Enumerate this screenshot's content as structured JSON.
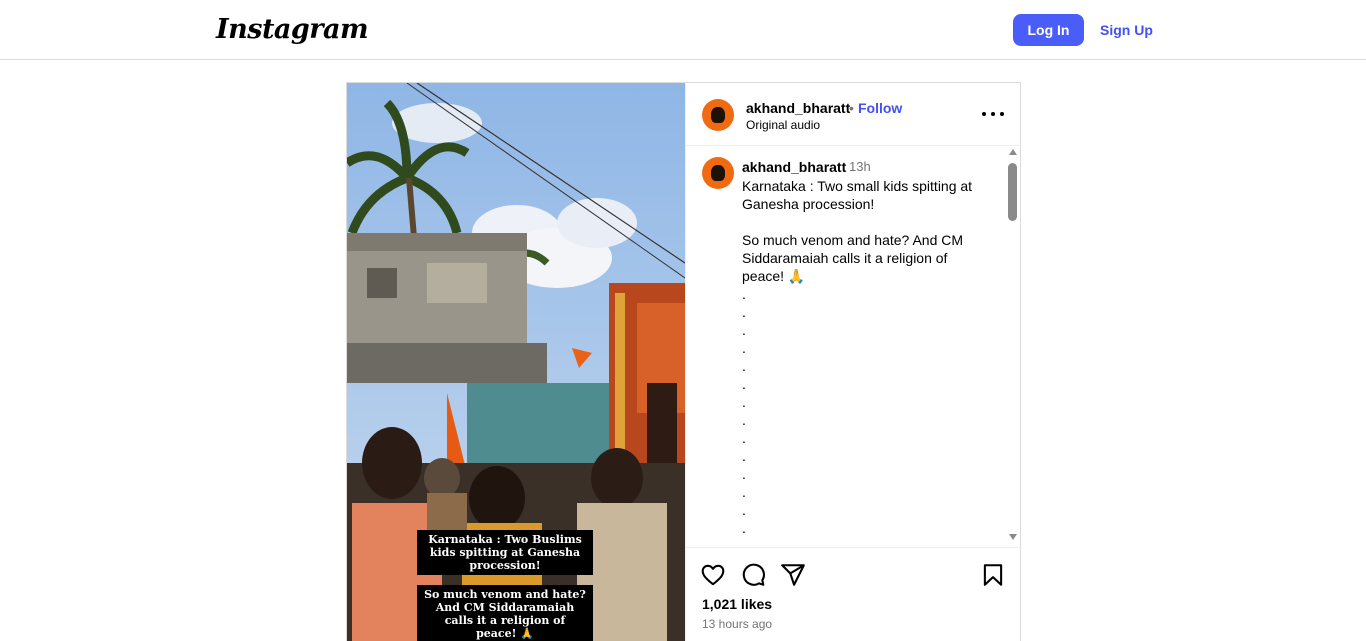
{
  "header": {
    "logo_text": "Instagram",
    "login_label": "Log In",
    "signup_label": "Sign Up",
    "accent_color": "#4a5df9"
  },
  "post": {
    "username": "akhand_bharatt",
    "separator": "•",
    "follow_label": "Follow",
    "audio_label": "Original audio",
    "more_icon": "more-horizontal-icon",
    "video_overlay": {
      "line1": "Karnataka : Two Buslims kids spitting at Ganesha procession!",
      "line2": "So much venom and hate? And CM Siddaramaiah calls it a religion of peace! 🙏"
    },
    "caption": {
      "username": "akhand_bharatt",
      "time": "13h",
      "text": "Karnataka : Two small kids spitting at Ganesha procession!\n\nSo much venom and hate?  And CM Siddaramaiah calls it a religion of peace! 🙏\n.\n.\n.\n.\n.\n.\n.\n.\n.\n.\n.\n.\n.\n.\n."
    },
    "likes": "1,021 likes",
    "time_ago": "13 hours ago",
    "icons": [
      "heart-icon",
      "comment-icon",
      "share-icon",
      "bookmark-icon"
    ]
  }
}
